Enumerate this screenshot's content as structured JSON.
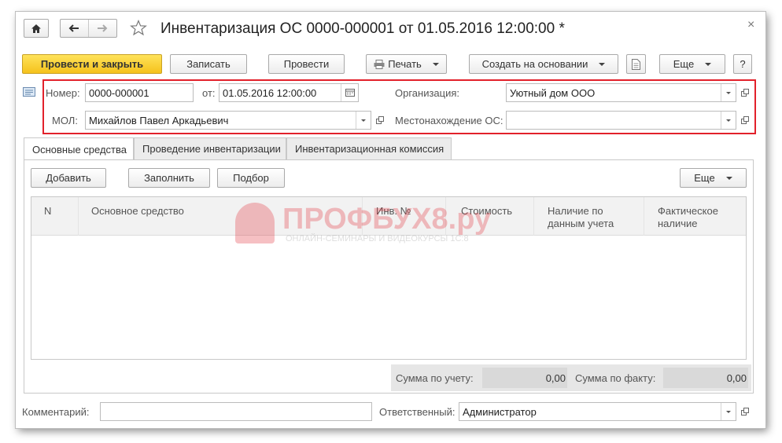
{
  "window": {
    "title": "Инвентаризация ОС 0000-000001 от 01.05.2016 12:00:00 *",
    "close_glyph": "×"
  },
  "toolbar": {
    "post_and_close": "Провести и закрыть",
    "save": "Записать",
    "post": "Провести",
    "print": "Печать",
    "create_based_on": "Создать на основании",
    "more": "Еще",
    "help": "?"
  },
  "header_fields": {
    "number_label": "Номер:",
    "number_value": "0000-000001",
    "date_label": "от:",
    "date_value": "01.05.2016 12:00:00",
    "org_label": "Организация:",
    "org_value": "Уютный дом ООО",
    "mol_label": "МОЛ:",
    "mol_value": "Михайлов Павел Аркадьевич",
    "location_label": "Местонахождение ОС:",
    "location_value": ""
  },
  "tabs": [
    {
      "label": "Основные средства",
      "active": true
    },
    {
      "label": "Проведение инвентаризации",
      "active": false
    },
    {
      "label": "Инвентаризационная комиссия",
      "active": false
    }
  ],
  "table_toolbar": {
    "add": "Добавить",
    "fill": "Заполнить",
    "pick": "Подбор",
    "more": "Еще"
  },
  "table": {
    "columns": [
      "N",
      "Основное средство",
      "Инв. №",
      "Стоимость",
      "Наличие по данным учета",
      "Фактическое наличие"
    ],
    "rows": []
  },
  "totals": {
    "accounting_label": "Сумма по учету:",
    "accounting_value": "0,00",
    "actual_label": "Сумма по факту:",
    "actual_value": "0,00"
  },
  "footer": {
    "comment_label": "Комментарий:",
    "comment_value": "",
    "responsible_label": "Ответственный:",
    "responsible_value": "Администратор"
  },
  "watermark": {
    "brand": "ПРОФБУХ8.ру",
    "tagline": "ОНЛАЙН-СЕМИНАРЫ И ВИДЕОКУРСЫ 1С:8"
  },
  "colors": {
    "primary_button": "#f5c21c",
    "highlight_border": "#e2212b",
    "watermark": "#e9a0a0"
  }
}
